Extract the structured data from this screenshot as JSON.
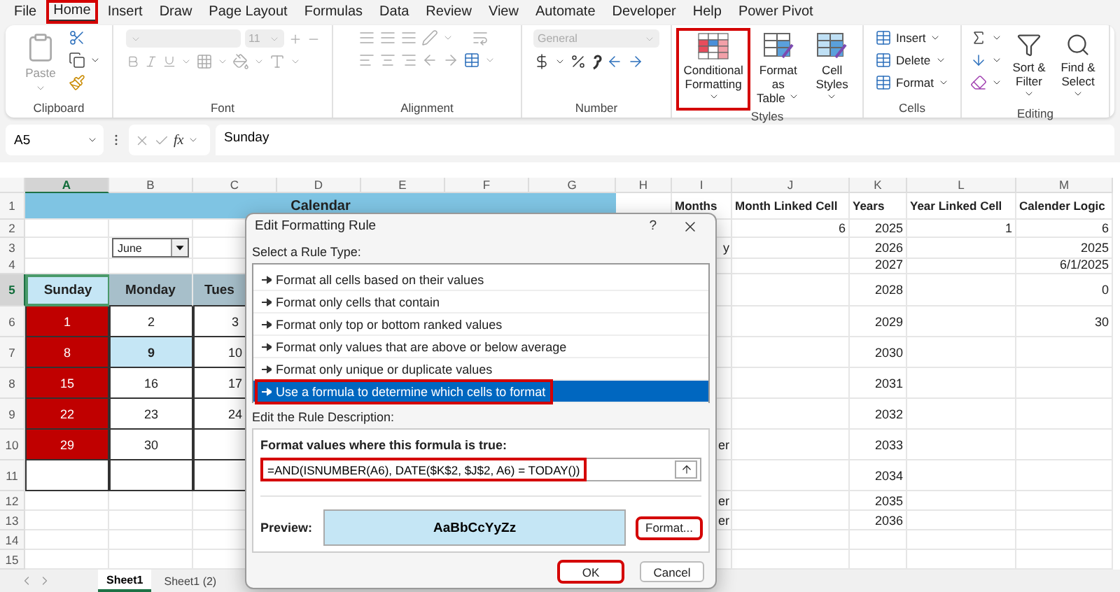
{
  "menu_tabs": [
    {
      "label": "File",
      "selected": false,
      "highlighted": false
    },
    {
      "label": "Home",
      "selected": true,
      "highlighted": true
    },
    {
      "label": "Insert",
      "selected": false,
      "highlighted": false
    },
    {
      "label": "Draw",
      "selected": false,
      "highlighted": false
    },
    {
      "label": "Page Layout",
      "selected": false,
      "highlighted": false
    },
    {
      "label": "Formulas",
      "selected": false,
      "highlighted": false
    },
    {
      "label": "Data",
      "selected": false,
      "highlighted": false
    },
    {
      "label": "Review",
      "selected": false,
      "highlighted": false
    },
    {
      "label": "View",
      "selected": false,
      "highlighted": false
    },
    {
      "label": "Automate",
      "selected": false,
      "highlighted": false
    },
    {
      "label": "Developer",
      "selected": false,
      "highlighted": false
    },
    {
      "label": "Help",
      "selected": false,
      "highlighted": false
    },
    {
      "label": "Power Pivot",
      "selected": false,
      "highlighted": false
    }
  ],
  "ribbon": {
    "groups": [
      {
        "kind": "clipboard",
        "label": "Clipboard",
        "paste": {
          "label": "Paste",
          "disabled": true
        }
      },
      {
        "kind": "font",
        "label": "Font",
        "disabled": true,
        "size": "11"
      },
      {
        "kind": "alignment",
        "label": "Alignment",
        "disabled": true
      },
      {
        "kind": "number",
        "label": "Number",
        "format": {
          "value": "General",
          "disabled": true
        }
      },
      {
        "kind": "styles",
        "label": "Styles",
        "buttons": [
          {
            "label": "Conditional Formatting",
            "highlighted": true
          },
          {
            "label": "Format as Table",
            "highlighted": false
          },
          {
            "label": "Cell Styles",
            "highlighted": false
          }
        ]
      },
      {
        "kind": "cells",
        "label": "Cells",
        "buttons": [
          "Insert",
          "Delete",
          "Format"
        ]
      },
      {
        "kind": "editing",
        "label": "Editing",
        "buttons": [
          "Sort & Filter",
          "Find & Select"
        ]
      }
    ]
  },
  "formula_bar": {
    "name_box": "A5",
    "function_label": "fx",
    "content": "Sunday"
  },
  "sheet": {
    "columns": [
      {
        "label": "A",
        "selected": true
      },
      {
        "label": "B",
        "selected": false
      },
      {
        "label": "C",
        "selected": false
      },
      {
        "label": "D",
        "selected": false
      },
      {
        "label": "E",
        "selected": false
      },
      {
        "label": "F",
        "selected": false
      },
      {
        "label": "G",
        "selected": false
      },
      {
        "label": "H",
        "selected": false
      },
      {
        "label": "I",
        "selected": false
      },
      {
        "label": "J",
        "selected": false
      },
      {
        "label": "K",
        "selected": false
      },
      {
        "label": "L",
        "selected": false
      },
      {
        "label": "M",
        "selected": false
      }
    ],
    "rows": [
      {
        "number": "1",
        "selected": false,
        "cells": {
          "a": {
            "kind": "title",
            "text": "Calendar"
          },
          "i": {
            "kind": "heading",
            "text": "Months"
          },
          "j": {
            "kind": "heading",
            "text": "Month Linked Cell"
          },
          "k": {
            "kind": "heading",
            "text": "Years"
          },
          "l": {
            "kind": "heading",
            "text": "Year Linked Cell"
          },
          "m": {
            "kind": "heading",
            "text": "Calender Logic"
          }
        }
      },
      {
        "number": "2",
        "selected": false,
        "cells": {
          "j": {
            "kind": "number",
            "text": "6"
          },
          "k": {
            "kind": "number",
            "text": "2025"
          },
          "l": {
            "kind": "number",
            "text": "1"
          },
          "m": {
            "kind": "number",
            "text": "6"
          }
        }
      },
      {
        "number": "3",
        "selected": false,
        "cells": {
          "b": {
            "kind": "dropdown",
            "text": "June"
          },
          "i": {
            "kind": "clipped",
            "text": "y"
          },
          "k": {
            "kind": "number",
            "text": "2026"
          },
          "m": {
            "kind": "number",
            "text": "2025"
          }
        }
      },
      {
        "number": "4",
        "selected": false,
        "cells": {
          "k": {
            "kind": "number",
            "text": "2027"
          },
          "m": {
            "kind": "number",
            "text": "6/1/2025"
          }
        }
      },
      {
        "number": "5",
        "selected": true,
        "cells": {
          "a": {
            "kind": "day_header",
            "text": "Sunday"
          },
          "b": {
            "kind": "day_header_alt",
            "text": "Monday"
          },
          "c": {
            "kind": "day_header_cut",
            "text": "Tues"
          },
          "k": {
            "kind": "number",
            "text": "2028"
          },
          "m": {
            "kind": "number",
            "text": "0"
          }
        }
      },
      {
        "number": "6",
        "selected": false,
        "cells": {
          "a": {
            "kind": "weekend",
            "text": "1"
          },
          "b": {
            "kind": "date",
            "text": "2"
          },
          "c": {
            "kind": "date",
            "text": "3"
          },
          "k": {
            "kind": "number",
            "text": "2029"
          },
          "m": {
            "kind": "number",
            "text": "30"
          }
        }
      },
      {
        "number": "7",
        "selected": false,
        "cells": {
          "a": {
            "kind": "weekend",
            "text": "8"
          },
          "b": {
            "kind": "today",
            "text": "9"
          },
          "c": {
            "kind": "date",
            "text": "10"
          },
          "k": {
            "kind": "number",
            "text": "2030"
          }
        }
      },
      {
        "number": "8",
        "selected": false,
        "cells": {
          "a": {
            "kind": "weekend",
            "text": "15"
          },
          "b": {
            "kind": "date",
            "text": "16"
          },
          "c": {
            "kind": "date",
            "text": "17"
          },
          "k": {
            "kind": "number",
            "text": "2031"
          }
        }
      },
      {
        "number": "9",
        "selected": false,
        "cells": {
          "a": {
            "kind": "weekend",
            "text": "22"
          },
          "b": {
            "kind": "date",
            "text": "23"
          },
          "c": {
            "kind": "date",
            "text": "24"
          },
          "k": {
            "kind": "number",
            "text": "2032"
          }
        }
      },
      {
        "number": "10",
        "selected": false,
        "cells": {
          "a": {
            "kind": "weekend",
            "text": "29"
          },
          "b": {
            "kind": "date",
            "text": "30"
          },
          "c": {
            "kind": "calendar_blank"
          },
          "i": {
            "kind": "clipped",
            "text": "er"
          },
          "k": {
            "kind": "number",
            "text": "2033"
          }
        }
      },
      {
        "number": "11",
        "selected": false,
        "cells": {
          "a": {
            "kind": "calendar_blank"
          },
          "b": {
            "kind": "calendar_blank"
          },
          "c": {
            "kind": "calendar_blank"
          },
          "k": {
            "kind": "number",
            "text": "2034"
          }
        }
      },
      {
        "number": "12",
        "selected": false,
        "cells": {
          "i": {
            "kind": "clipped",
            "text": "er"
          },
          "k": {
            "kind": "number",
            "text": "2035"
          }
        }
      },
      {
        "number": "13",
        "selected": false,
        "cells": {
          "i": {
            "kind": "clipped",
            "text": "er"
          },
          "k": {
            "kind": "number",
            "text": "2036"
          }
        }
      },
      {
        "number": "14",
        "selected": false,
        "cells": {}
      },
      {
        "number": "15",
        "selected": false,
        "cells": {}
      }
    ]
  },
  "sheet_tabs": [
    {
      "label": "Sheet1",
      "selected": true
    },
    {
      "label": "Sheet1 (2)",
      "selected": false
    }
  ],
  "dialog": {
    "title": "Edit Formatting Rule",
    "help": "?",
    "rule_type_label": "Select a Rule Type:",
    "rule_types": [
      {
        "label": "Format all cells based on their values",
        "selected": false,
        "highlighted": false
      },
      {
        "label": "Format only cells that contain",
        "selected": false,
        "highlighted": false
      },
      {
        "label": "Format only top or bottom ranked values",
        "selected": false,
        "highlighted": false
      },
      {
        "label": "Format only values that are above or below average",
        "selected": false,
        "highlighted": false
      },
      {
        "label": "Format only unique or duplicate values",
        "selected": false,
        "highlighted": false
      },
      {
        "label": "Use a formula to determine which cells to format",
        "selected": true,
        "highlighted": true
      }
    ],
    "description_label": "Edit the Rule Description:",
    "formula_label": "Format values where this formula is true:",
    "formula": {
      "value": "=AND(ISNUMBER(A6), DATE($K$2, $J$2, A6) = TODAY())",
      "highlighted": true
    },
    "preview_label": "Preview:",
    "preview_text": "AaBbCcYyZz",
    "buttons": [
      {
        "kind": "format",
        "label": "Format...",
        "highlighted": true
      },
      {
        "kind": "ok",
        "label": "OK",
        "highlighted": true
      },
      {
        "kind": "cancel",
        "label": "Cancel",
        "highlighted": false
      }
    ]
  }
}
